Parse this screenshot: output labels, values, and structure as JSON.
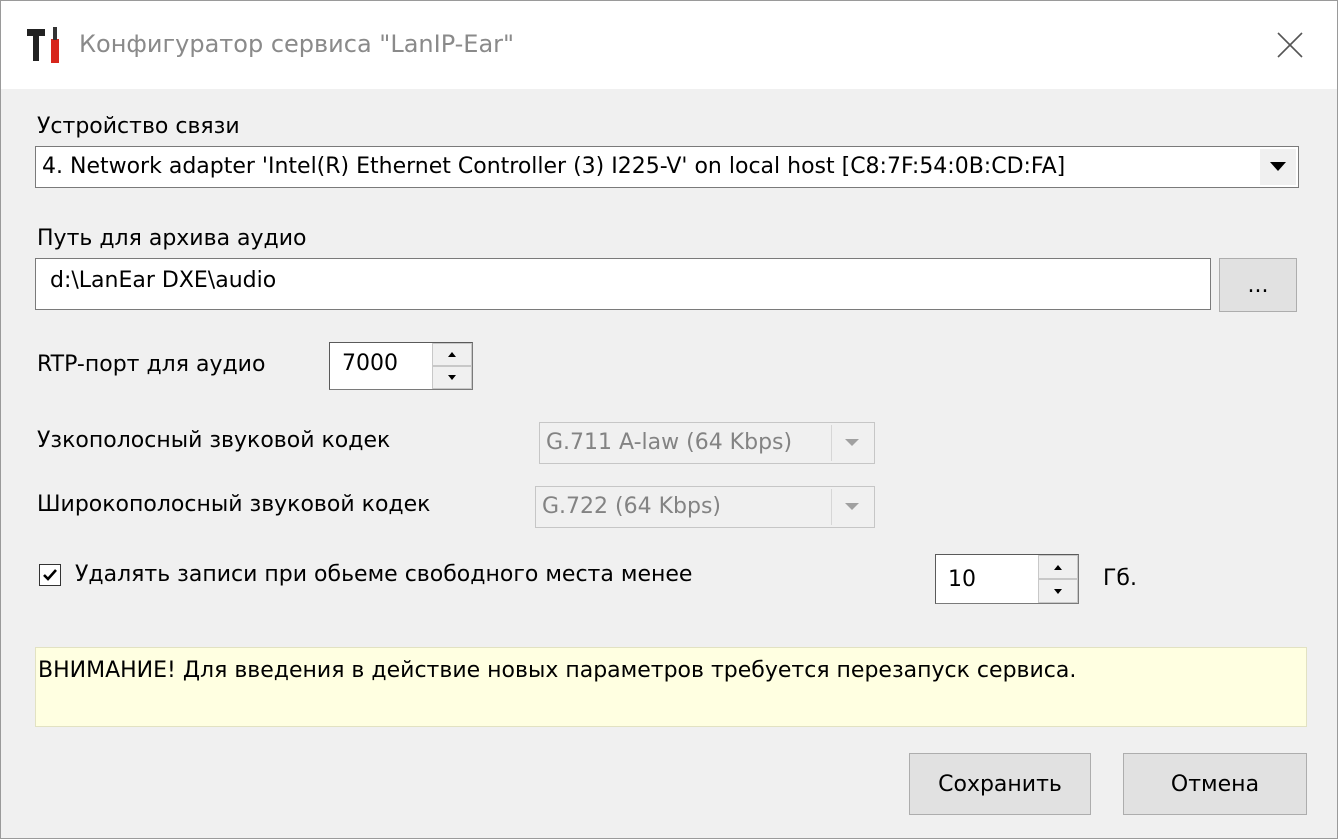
{
  "window": {
    "title": "Конфигуратор сервиса \"LanIP-Ear\"",
    "app_icon": "tools-icon",
    "close_icon": "close-icon"
  },
  "device": {
    "label": "Устройство связи",
    "selected": "4. Network adapter 'Intel(R) Ethernet Controller (3) I225-V' on local host [C8:7F:54:0B:CD:FA]"
  },
  "archive": {
    "label": "Путь для архива аудио",
    "path": "d:\\LanEar DXE\\audio",
    "browse_label": "..."
  },
  "rtp": {
    "label": "RTP-порт для аудио",
    "value": "7000"
  },
  "narrowband": {
    "label": "Узкополосный звуковой кодек",
    "selected": "G.711 A-law (64 Kbps)",
    "enabled": false
  },
  "wideband": {
    "label": "Широкополосный звуковой кодек",
    "selected": "G.722 (64 Kbps)",
    "enabled": false
  },
  "cleanup": {
    "checked": true,
    "label": "Удалять записи при обьеме свободного места менее",
    "value": "10",
    "unit": "Гб."
  },
  "warning": {
    "text": "ВНИМАНИЕ! Для введения в действие новых параметров требуется перезапуск сервиса."
  },
  "buttons": {
    "save": "Сохранить",
    "cancel": "Отмена"
  },
  "colors": {
    "window_bg": "#f0f0f0",
    "warning_bg": "#ffffe1",
    "title_gray": "#8a8a8a"
  }
}
